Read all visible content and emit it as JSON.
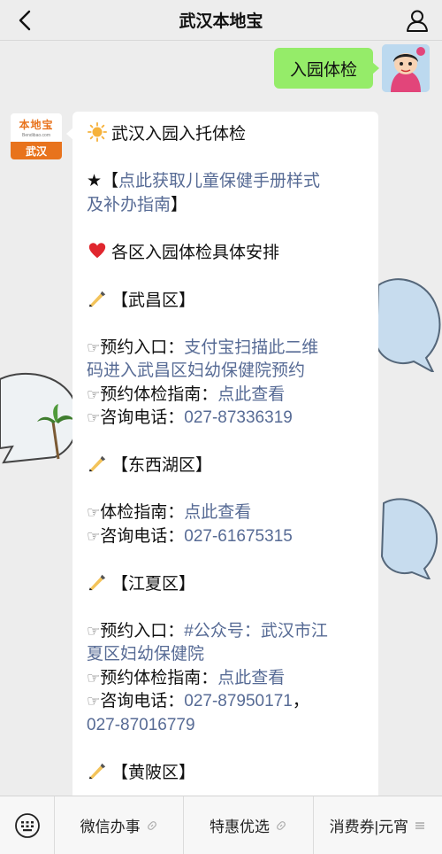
{
  "header": {
    "title": "武汉本地宝"
  },
  "user_message": {
    "text": "入园体检"
  },
  "bot_avatar": {
    "logo_text": "本地宝",
    "domain": "Bendibao.com",
    "city": "武汉"
  },
  "article": {
    "title": "武汉入园入托体检",
    "handbook_prefix": "★【",
    "handbook_link_line1": "点此获取儿童保健手册样式",
    "handbook_link_line2": "及补办指南",
    "handbook_suffix": "】",
    "districts_heading": "各区入园体检具体安排",
    "wuchang": {
      "name": "【武昌区】",
      "booking_label": "预约入口：",
      "booking_link_line1": "支付宝扫描此二维",
      "booking_link_line2": "码进入武昌区妇幼保健院预约",
      "guide_label": "预约体检指南：",
      "guide_link": "点此查看",
      "phone_label": "咨询电话：",
      "phone": "027-87336319"
    },
    "dongxihu": {
      "name": "【东西湖区】",
      "guide_label": "体检指南：",
      "guide_link": "点此查看",
      "phone_label": "咨询电话：",
      "phone": "027-61675315"
    },
    "jiangxia": {
      "name": "【江夏区】",
      "booking_label": "预约入口：",
      "booking_link_line1": "#公众号：武汉市江",
      "booking_link_line2": "夏区妇幼保健院",
      "guide_label": "预约体检指南：",
      "guide_link": "点此查看",
      "phone_label": "咨询电话：",
      "phone1": "027-87950171",
      "phone_sep": "，",
      "phone2": "027-87016779"
    },
    "huangpi": {
      "name": "【黄陂区】"
    },
    "pointer_glyph": "☞"
  },
  "bottom_menu": {
    "items": [
      {
        "label": "微信办事"
      },
      {
        "label": "特惠优选"
      },
      {
        "label": "消费券|元宵"
      }
    ]
  },
  "colors": {
    "link": "#576b95",
    "user_bubble": "#95ec69",
    "brand_orange": "#e8731d"
  }
}
